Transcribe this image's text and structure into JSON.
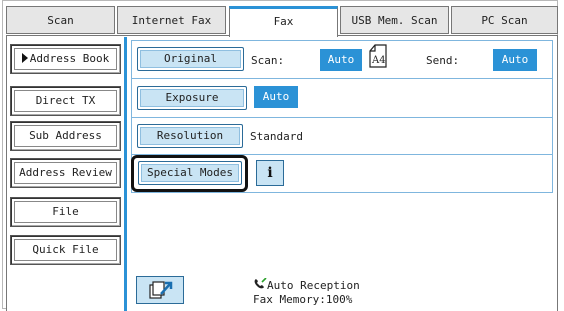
{
  "tabs": [
    {
      "label": "Scan",
      "active": false
    },
    {
      "label": "Internet Fax",
      "active": false
    },
    {
      "label": "Fax",
      "active": true
    },
    {
      "label": "USB Mem. Scan",
      "active": false
    },
    {
      "label": "PC Scan",
      "active": false
    }
  ],
  "left_menu": {
    "address_book": "Address Book",
    "direct_tx": "Direct TX",
    "sub_address": "Sub Address",
    "address_review": "Address Review",
    "file": "File",
    "quick_file": "Quick File"
  },
  "settings": {
    "original_button": "Original",
    "scan_label": "Scan:",
    "scan_value": "Auto",
    "paper_size": "A4",
    "send_label": "Send:",
    "send_value": "Auto",
    "exposure_button": "Exposure",
    "exposure_value": "Auto",
    "resolution_button": "Resolution",
    "resolution_value": "Standard",
    "special_modes_button": "Special Modes",
    "info_icon": "info-icon"
  },
  "status": {
    "reception": "Auto Reception",
    "memory": "Fax Memory:100%"
  },
  "colors": {
    "accent": "#2b92d6",
    "button_fill": "#c9e4f4"
  }
}
